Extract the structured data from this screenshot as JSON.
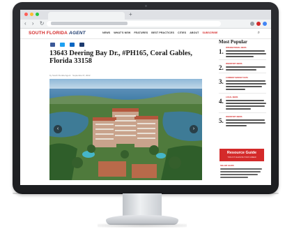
{
  "site": {
    "logo": "SOUTH FLORIDA",
    "logo_suffix": "AGENT",
    "nav": [
      "NEWS",
      "WHAT'S NEW",
      "FEATURES",
      "BEST PRACTICES",
      "CITIES",
      "ABOUT",
      "SUBSCRIBE"
    ]
  },
  "article": {
    "title": "13643 Deering Bay Dr., #PH165, Coral Gables, Florida 33158",
    "byline": "by South Florida Agent · September 8, 2022"
  },
  "sidebar": {
    "title": "Most Popular",
    "items": [
      {
        "num": "1.",
        "category": "INTERNATIONAL NEWS"
      },
      {
        "num": "2.",
        "category": "INVENTORY NEWS"
      },
      {
        "num": "3.",
        "category": "CURRENT MARKET DATA"
      },
      {
        "num": "4.",
        "category": "LOCAL NEWS"
      },
      {
        "num": "5.",
        "category": "INVENTORY NEWS"
      }
    ],
    "resource_guide": {
      "title": "Resource Guide",
      "subtitle": "TOOLS TO ELEVATE YOUR CAREER",
      "category": "SELLER LEADS"
    }
  },
  "colors": {
    "brand_red": "#d42a2a",
    "brand_navy": "#1d3b6e"
  }
}
